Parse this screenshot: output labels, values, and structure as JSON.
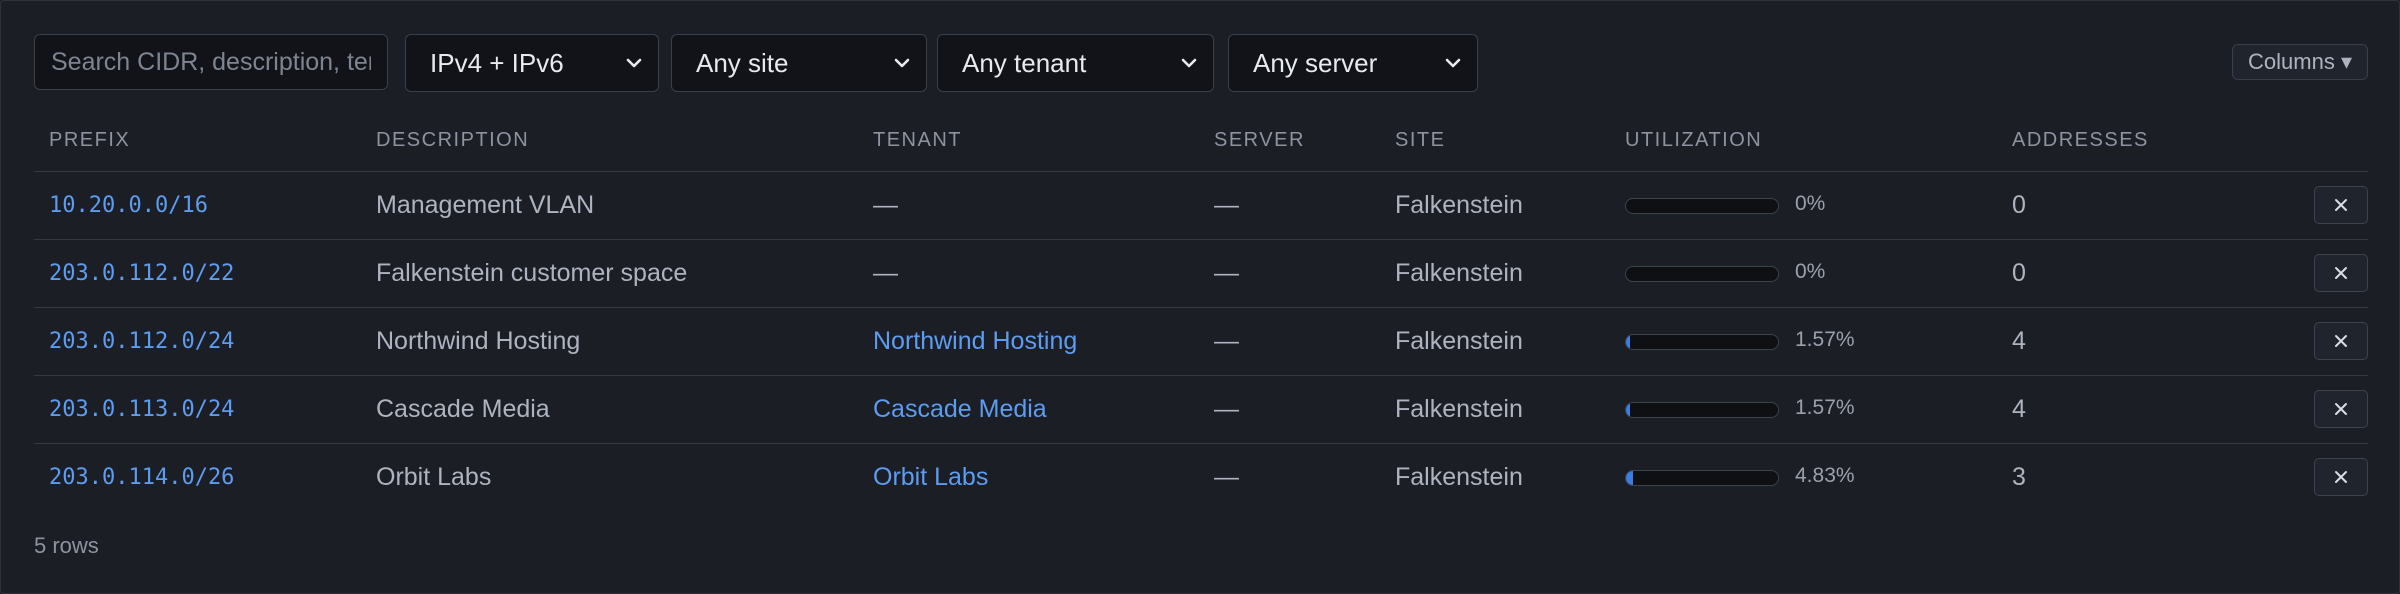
{
  "toolbar": {
    "search_placeholder": "Search CIDR, description, tenant",
    "family_filter": "IPv4 + IPv6",
    "site_filter": "Any site",
    "tenant_filter": "Any tenant",
    "server_filter": "Any server",
    "columns_label": "Columns ▾"
  },
  "table": {
    "headers": [
      "PREFIX",
      "DESCRIPTION",
      "TENANT",
      "SERVER",
      "SITE",
      "UTILIZATION",
      "ADDRESSES"
    ],
    "rows": [
      {
        "prefix": "10.20.0.0/16",
        "description": "Management VLAN",
        "tenant": "—",
        "tenant_link": false,
        "server": "—",
        "site": "Falkenstein",
        "utilization_label": "0%",
        "utilization": 0,
        "addresses": "0"
      },
      {
        "prefix": "203.0.112.0/22",
        "description": "Falkenstein customer space",
        "tenant": "—",
        "tenant_link": false,
        "server": "—",
        "site": "Falkenstein",
        "utilization_label": "0%",
        "utilization": 0,
        "addresses": "0"
      },
      {
        "prefix": "203.0.112.0/24",
        "description": "Northwind Hosting",
        "tenant": "Northwind Hosting",
        "tenant_link": true,
        "server": "—",
        "site": "Falkenstein",
        "utilization_label": "1.57%",
        "utilization": 1.57,
        "addresses": "4"
      },
      {
        "prefix": "203.0.113.0/24",
        "description": "Cascade Media",
        "tenant": "Cascade Media",
        "tenant_link": true,
        "server": "—",
        "site": "Falkenstein",
        "utilization_label": "1.57%",
        "utilization": 1.57,
        "addresses": "4"
      },
      {
        "prefix": "203.0.114.0/26",
        "description": "Orbit Labs",
        "tenant": "Orbit Labs",
        "tenant_link": true,
        "server": "—",
        "site": "Falkenstein",
        "utilization_label": "4.83%",
        "utilization": 4.83,
        "addresses": "3"
      }
    ]
  },
  "footer": {
    "row_count": "5 rows"
  },
  "colors": {
    "link": "#5d9cf0",
    "background": "#1b1e25",
    "bar_fill": "#3b7de0"
  },
  "icons": {
    "select_chevron": "chevron-down-icon",
    "row_delete": "close-icon"
  }
}
